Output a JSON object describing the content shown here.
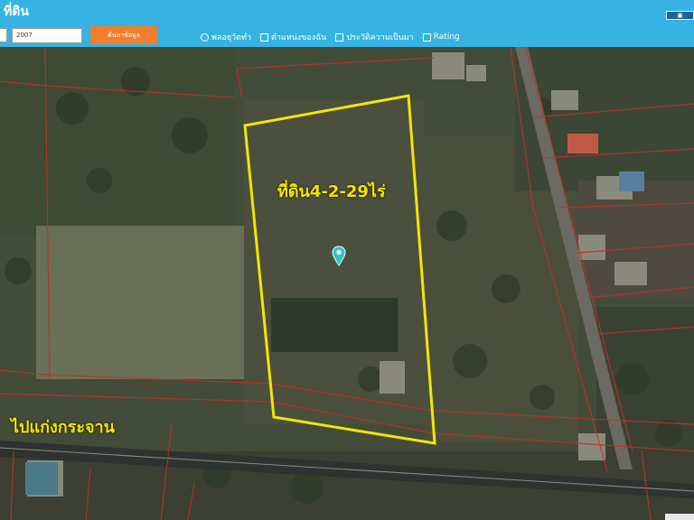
{
  "header": {
    "title": "ที่ดิน",
    "year_value": "2007",
    "search_button_label": "ค้นหาข้อมูล",
    "options": [
      {
        "kind": "radio",
        "label": "พลอยุวัตทำ"
      },
      {
        "kind": "checkbox",
        "label": "ตำแหน่งของฉัน"
      },
      {
        "kind": "checkbox",
        "label": "ประวัติความเป็นมา"
      },
      {
        "kind": "checkbox",
        "label": "Rating"
      }
    ]
  },
  "map": {
    "plot_label": "ที่ดิน4-2-29ไร่",
    "road_label": "ไปแก่งกระจาน",
    "boundary_color": "#f2e600",
    "parcel_line_color": "#c0302a",
    "marker_icon": "map-pin-icon"
  }
}
